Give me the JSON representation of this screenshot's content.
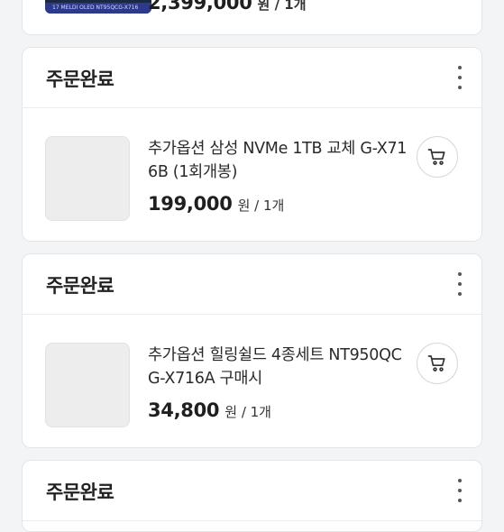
{
  "orders": [
    {
      "status": "",
      "title": "",
      "price": "2,399,000",
      "unit": "원 / 1개",
      "thumb_text": "17 MELDI OLED NT95QCG-X716"
    },
    {
      "status": "주문완료",
      "title": "추가옵션 삼성 NVMe 1TB 교체 G-X716B (1회개봉)",
      "price": "199,000",
      "unit": "원 / 1개"
    },
    {
      "status": "주문완료",
      "title": "추가옵션 힐링쉴드 4종세트 NT950QCG-X716A 구매시",
      "price": "34,800",
      "unit": "원 / 1개"
    },
    {
      "status": "주문완료"
    }
  ],
  "icons": {
    "more": "more-vertical-icon",
    "cart": "cart-icon"
  },
  "colors": {
    "background": "#f3f4f6",
    "card": "#ffffff",
    "thumbnail": "#ededee"
  }
}
